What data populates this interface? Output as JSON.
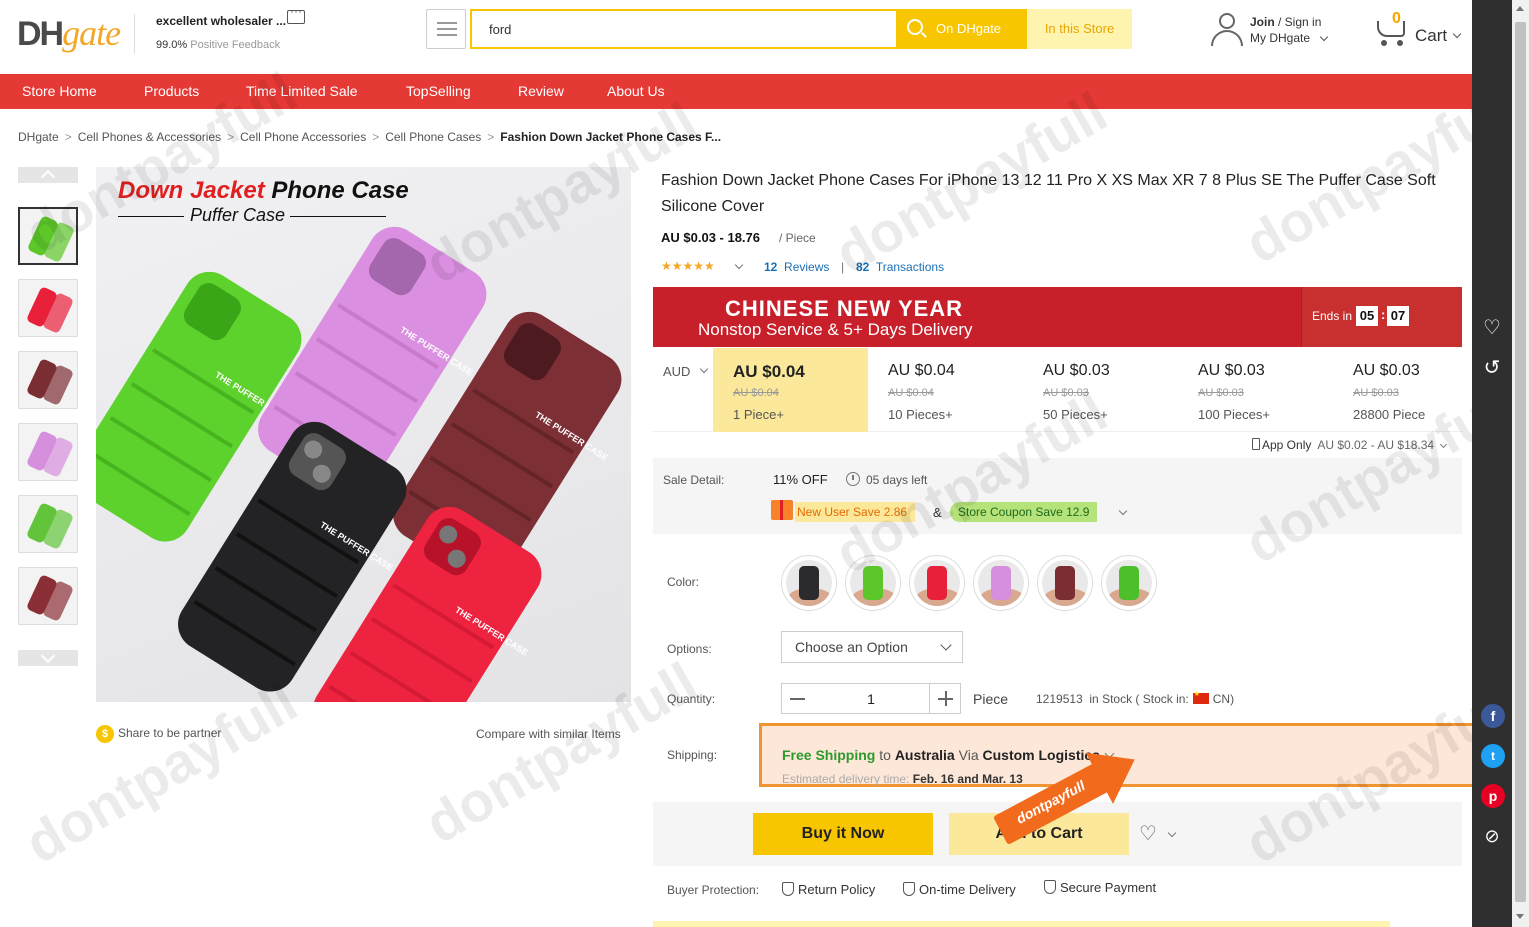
{
  "header": {
    "logo_dh": "DH",
    "logo_gate": "gate",
    "store_name": "excellent wholesaler ...",
    "feedback_value": "99.0%",
    "feedback_label": "Positive Feedback",
    "search_value": "ford",
    "search_button": "On DHgate",
    "store_button": "In this Store",
    "join_bold": "Join",
    "join_rest": " / Sign in",
    "my_dhgate": "My DHgate",
    "cart_count": "0",
    "cart_label": "Cart"
  },
  "nav": {
    "items": [
      "Store Home",
      "Products",
      "Time Limited Sale",
      "TopSelling",
      "Review",
      "About Us"
    ]
  },
  "breadcrumb": {
    "items": [
      "DHgate",
      "Cell Phones & Accessories",
      "Cell Phone Accessories",
      "Cell Phone Cases"
    ],
    "current": "Fashion Down Jacket Phone Cases F..."
  },
  "gallery": {
    "image_title_red": "Down Jacket",
    "image_title_black": " Phone Case",
    "image_subtitle": "Puffer Case",
    "case_print": "THE PUFFER CASE",
    "share_partner": "Share to be partner",
    "compare": "Compare with similar Items",
    "thumb_colors": [
      "#5dc72a",
      "#e8203a",
      "#7a2e33",
      "#d68fdc",
      "#62c43a",
      "#8a2f36"
    ]
  },
  "product": {
    "title": "Fashion Down Jacket Phone Cases For iPhone 13 12 11 Pro X XS Max XR 7 8 Plus SE The Puffer Case Soft Silicone Cover",
    "price_range": "AU $0.03 - 18.76",
    "per_piece": "/ Piece",
    "stars": "★★★★★",
    "rating": 5,
    "reviews_count": "12",
    "reviews_label": "Reviews",
    "separator": "|",
    "transactions_count": "82",
    "transactions_label": "Transactions"
  },
  "banner": {
    "title": "CHINESE NEW YEAR",
    "subtitle": "Nonstop Service & 5+ Days Delivery",
    "ends_label": "Ends in",
    "hours": "05",
    "colon": ":",
    "minutes": "07"
  },
  "pricing": {
    "currency": "AUD",
    "tiers": [
      {
        "price": "AU $0.04",
        "old": "AU $0.04",
        "qty": "1 Piece+"
      },
      {
        "price": "AU $0.04",
        "old": "AU $0.04",
        "qty": "10 Pieces+"
      },
      {
        "price": "AU $0.03",
        "old": "AU $0.03",
        "qty": "50 Pieces+"
      },
      {
        "price": "AU $0.03",
        "old": "AU $0.03",
        "qty": "100 Pieces+"
      },
      {
        "price": "AU $0.03",
        "old": "AU $0.03",
        "qty": "28800 Piece"
      }
    ],
    "app_only": "App Only",
    "app_range": "AU $0.02 - AU $18.34"
  },
  "sale": {
    "label": "Sale Detail:",
    "off": "11% OFF",
    "days_left": "05 days left",
    "new_user": "New User Save 2.86",
    "amp": "&",
    "coupon": "Store Coupon Save 12.9"
  },
  "options": {
    "color_label": "Color:",
    "options_label": "Options:",
    "select_value": "Choose an Option",
    "quantity_label": "Quantity:",
    "quantity_value": "1",
    "unit": "Piece",
    "stock_count": "1219513",
    "stock_text": "in Stock ( Stock in:",
    "stock_country": "CN)",
    "swatch_colors": [
      "#2b2b2e",
      "#5dc72a",
      "#e8203a",
      "#d68fdc",
      "#7a2e33",
      "#4cbf2a"
    ]
  },
  "shipping": {
    "label": "Shipping:",
    "free": "Free Shipping",
    "to": " to ",
    "country": "Australia",
    "via": " Via ",
    "method": "Custom Logistics",
    "est_label": "Estimated delivery time:",
    "est_dates": "Feb. 16 and Mar. 13"
  },
  "actions": {
    "buy_now": "Buy it Now",
    "add_cart": "Add to Cart",
    "fav": "♡"
  },
  "protection": {
    "label": "Buyer Protection:",
    "return_policy": "Return Policy",
    "on_time": "On-time Delivery",
    "secure": "Secure Payment"
  },
  "overlay": {
    "watermark": "dontpayfull",
    "arrow_text": "dontpayfull"
  },
  "colors": {
    "brand_red": "#e53935",
    "brand_yellow": "#f7c600",
    "banner_red": "#c8202b",
    "link_blue": "#1a6fb5",
    "highlight_orange": "#f0952f"
  }
}
